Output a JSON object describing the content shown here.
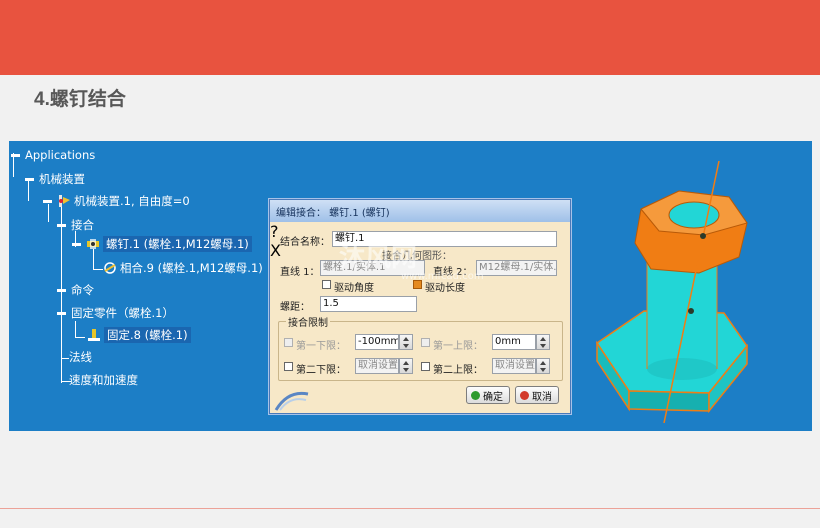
{
  "slide": {
    "title": "4.螺钉结合"
  },
  "tree": {
    "root": "Applications",
    "mechanism": "机械装置",
    "mechanism_sub": "机械装置.1, 自由度=0",
    "joints": "接合",
    "screw_joint": "螺钉.1 (螺栓.1,M12螺母.1)",
    "coincide": "相合.9 (螺栓.1,M12螺母.1)",
    "commands": "命令",
    "fixed_part": "固定零件（螺栓.1）",
    "fixed": "固定.8 (螺栓.1)",
    "laws": "法线",
    "speed_acc": "速度和加速度"
  },
  "dialog": {
    "title": "编辑接合： 螺钉.1 (螺钉)",
    "help_btn": "?",
    "close_btn": "X",
    "name_label": "结合名称：",
    "name_value": "螺钉.1",
    "geom_label": "接合几何图形：",
    "line1_label": "直线 1：",
    "line1_value": "螺栓.1/实体.1",
    "line2_label": "直线 2：",
    "line2_value": "M12螺母.1/实体.1",
    "drive_angle": "驱动角度",
    "drive_length": "驱动长度",
    "pitch_label": "螺距：",
    "pitch_value": "1.5",
    "limits_group": "接合限制",
    "first_lower": "第一下限：",
    "first_lower_value": "-100mm",
    "first_upper": "第一上限：",
    "first_upper_value": "0mm",
    "second_lower": "第二下限：",
    "second_lower_value": "取消设置",
    "second_upper": "第二上限：",
    "second_upper_value": "取消设置",
    "ok": "确定",
    "cancel": "取消"
  },
  "watermark": {
    "main": "沐风网",
    "sub": "www.mfcad.com"
  },
  "colors": {
    "header": "#e8533f",
    "panel": "#1c7ec6",
    "nut": "#f07d14",
    "bolt": "#22d6d6"
  }
}
